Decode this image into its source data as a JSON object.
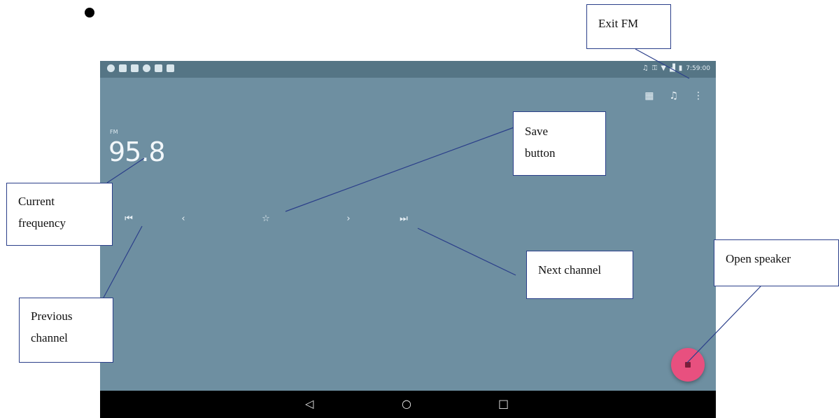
{
  "screen": {
    "frequency": "95.8",
    "band_label": "FM",
    "status_time": "7:59:00",
    "status_icons": [
      "notification-icon",
      "mail-icon",
      "screenshot-icon",
      "circle-icon",
      "lock-icon",
      "chat-icon"
    ],
    "right_status_icons": [
      "headset-icon",
      "key-icon",
      "wifi-icon",
      "signal-icon",
      "battery-icon"
    ],
    "top_actions": [
      {
        "name": "channel-list-icon",
        "glyph": "▦"
      },
      {
        "name": "headset-icon",
        "glyph": "♫"
      },
      {
        "name": "more-menu-icon",
        "glyph": "⋮"
      }
    ],
    "controls": {
      "prev_channel": "⏮",
      "seek_back": "‹",
      "save": "☆",
      "seek_forward": "›",
      "next_channel": "⏭"
    },
    "nav": {
      "back": "◁",
      "home": "○",
      "recents": "□"
    },
    "accent": "#e8507f",
    "background": "#6e8fa1"
  },
  "callouts": {
    "exit_fm": "Exit FM",
    "save_line1": "Save",
    "save_line2": "button",
    "current_line1": "Current",
    "current_line2": "frequency",
    "next_channel": "Next channel",
    "open_speaker": "Open speaker",
    "previous_line1": "Previous",
    "previous_line2": "channel"
  }
}
